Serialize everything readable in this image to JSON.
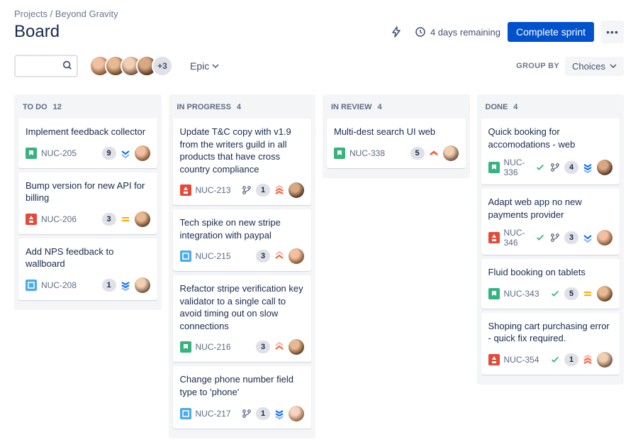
{
  "breadcrumb": "Projects / Beyond Gravity",
  "title": "Board",
  "remaining": "4 days remaining",
  "complete_label": "Complete sprint",
  "epic_label": "Epic",
  "group_by_label": "Group by",
  "choices_label": "Choices",
  "avatar_more": "+3",
  "columns": [
    {
      "name": "TO DO",
      "count": "12",
      "cards": [
        {
          "title": "Implement feedback collector",
          "key": "NUC-205",
          "type": "story",
          "points": "9",
          "priority": "low",
          "avatar": "av1"
        },
        {
          "title": "Bump version for new API for billing",
          "key": "NUC-206",
          "type": "improvement",
          "points": "3",
          "priority": "medium",
          "avatar": "av2"
        },
        {
          "title": "Add NPS feedback to wallboard",
          "key": "NUC-208",
          "type": "task",
          "points": "1",
          "priority": "lowest",
          "avatar": "av3"
        }
      ]
    },
    {
      "name": "IN PROGRESS",
      "count": "4",
      "cards": [
        {
          "title": "Update T&C copy with v1.9 from the writers guild in all products that have cross country compliance",
          "key": "NUC-213",
          "type": "improvement",
          "branch": true,
          "points": "1",
          "priority": "highest",
          "avatar": "av4"
        },
        {
          "title": "Tech spike on new stripe integration with paypal",
          "key": "NUC-215",
          "type": "task",
          "points": "3",
          "priority": "high",
          "avatar": "av1"
        },
        {
          "title": "Refactor stripe verification key validator to a single call to avoid timing out on slow connections",
          "key": "NUC-216",
          "type": "story",
          "points": "3",
          "priority": "high",
          "avatar": "av2"
        },
        {
          "title": "Change phone number field type to 'phone'",
          "key": "NUC-217",
          "type": "task",
          "branch": true,
          "points": "1",
          "priority": "lowest",
          "avatar": "av5"
        }
      ]
    },
    {
      "name": "IN REVIEW",
      "count": "4",
      "cards": [
        {
          "title": "Multi-dest search UI web",
          "key": "NUC-338",
          "type": "story",
          "points": "5",
          "priority": "high-single",
          "avatar": "av3"
        }
      ]
    },
    {
      "name": "DONE",
      "count": "4",
      "cards": [
        {
          "title": "Quick booking for accomodations - web",
          "key": "NUC-336",
          "type": "story",
          "done": true,
          "branch": true,
          "points": "4",
          "priority": "lowest",
          "avatar": "av4"
        },
        {
          "title": "Adapt web app no new payments provider",
          "key": "NUC-346",
          "type": "improvement",
          "done": true,
          "branch": true,
          "points": "3",
          "priority": "low",
          "avatar": "av1"
        },
        {
          "title": "Fluid booking on tablets",
          "key": "NUC-343",
          "type": "story",
          "done": true,
          "points": "5",
          "priority": "medium",
          "avatar": "av2"
        },
        {
          "title": "Shoping cart purchasing error - quick fix required.",
          "key": "NUC-354",
          "type": "improvement",
          "done": true,
          "points": "1",
          "priority": "highest",
          "avatar": "av3"
        }
      ]
    }
  ]
}
